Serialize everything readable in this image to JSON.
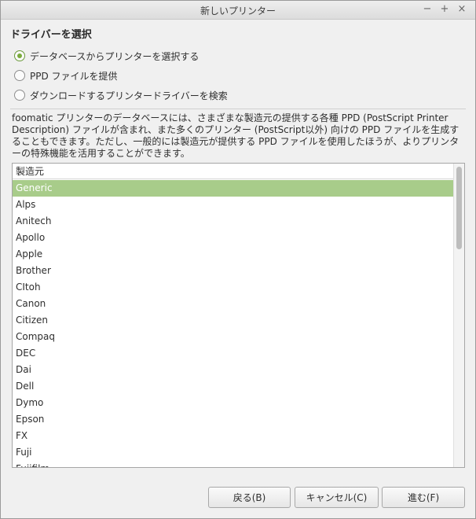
{
  "window": {
    "title": "新しいプリンター",
    "controls": [
      "−",
      "+",
      "×"
    ]
  },
  "heading": "ドライバーを選択",
  "options": [
    {
      "label": "データベースからプリンターを選択する",
      "checked": true
    },
    {
      "label": "PPD ファイルを提供",
      "checked": false
    },
    {
      "label": "ダウンロードするプリンタードライバーを検索",
      "checked": false
    }
  ],
  "description": "foomatic プリンターのデータベースには、さまざまな製造元の提供する各種 PPD (PostScript Printer Description) ファイルが含まれ、また多くのプリンター (PostScript以外) 向けの PPD ファイルを生成することもできます。ただし、一般的には製造元が提供する PPD ファイルを使用したほうが、よりプリンターの特殊機能を活用することができます。",
  "list": {
    "header": "製造元",
    "selected_index": 0,
    "items": [
      "Generic",
      "Alps",
      "Anitech",
      "Apollo",
      "Apple",
      "Brother",
      "CItoh",
      "Canon",
      "Citizen",
      "Compaq",
      "DEC",
      "Dai",
      "Dell",
      "Dymo",
      "Epson",
      "FX",
      "Fuji",
      "Fujifilm"
    ]
  },
  "buttons": {
    "back": "戻る(B)",
    "cancel": "キャンセル(C)",
    "forward": "進む(F)"
  },
  "colors": {
    "accent": "#7aab3c",
    "selection": "#a8cc8a"
  }
}
